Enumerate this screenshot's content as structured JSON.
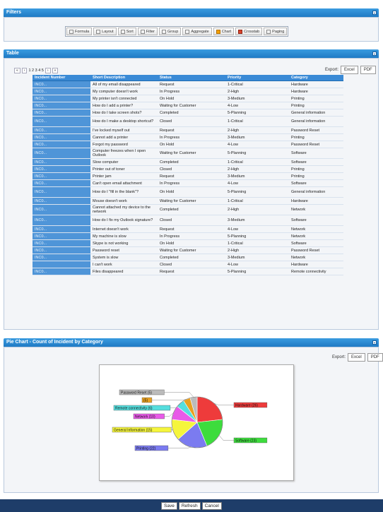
{
  "filters": {
    "title": "Filters",
    "buttons": [
      "Formula",
      "Layout",
      "Sort",
      "Filter",
      "Group",
      "Aggregate",
      "Chart",
      "Crosstab",
      "Paging"
    ]
  },
  "table_panel": {
    "title": "Table",
    "export_label": "Export:",
    "excel": "Excel",
    "pdf": "PDF",
    "pager": {
      "first": "«",
      "prev": "‹",
      "pages": "1 2 3 4 5",
      "next": "›",
      "last": "»"
    },
    "columns": [
      "Incident Number",
      "Short Description",
      "Status",
      "Priority",
      "Category"
    ],
    "rows": [
      [
        "INC0...",
        "All of my email disappeared",
        "Request",
        "1-Critical",
        "Hardware"
      ],
      [
        "INC0...",
        "My computer doesn't work",
        "In Progress",
        "2-High",
        "Hardware"
      ],
      [
        "INC0...",
        "My printer isn't connected",
        "On Hold",
        "3-Medium",
        "Printing"
      ],
      [
        "INC0...",
        "How do I add a printer?",
        "Waiting for Customer",
        "4-Low",
        "Printing"
      ],
      [
        "INC0...",
        "How do I take screen shots?",
        "Completed",
        "5-Planning",
        "General information"
      ],
      [
        "INC0...",
        "How do I make a desktop shortcut?",
        "Closed",
        "1-Critical",
        "General information"
      ],
      [
        "INC0...",
        "I've locked myself out",
        "Request",
        "2-High",
        "Password Reset"
      ],
      [
        "INC0...",
        "Cannot add a printer",
        "In Progress",
        "3-Medium",
        "Printing"
      ],
      [
        "INC0...",
        "Forgot my password",
        "On Hold",
        "4-Low",
        "Password Reset"
      ],
      [
        "INC0...",
        "Computer freezes when I open Outlook",
        "Waiting for Customer",
        "5-Planning",
        "Software"
      ],
      [
        "INC0...",
        "Slow computer",
        "Completed",
        "1-Critical",
        "Software"
      ],
      [
        "INC0...",
        "Printer out of toner",
        "Closed",
        "2-High",
        "Printing"
      ],
      [
        "INC0...",
        "Printer jam",
        "Request",
        "3-Medium",
        "Printing"
      ],
      [
        "INC0...",
        "Can't open email attachment",
        "In Progress",
        "4-Low",
        "Software"
      ],
      [
        "INC0...",
        "How do I \"fill in the blank\"?",
        "On Hold",
        "5-Planning",
        "General information"
      ],
      [
        "INC0...",
        "Mouse doesn't work",
        "Waiting for Customer",
        "1-Critical",
        "Hardware"
      ],
      [
        "INC0...",
        "Cannot attached my device to the network",
        "Completed",
        "2-High",
        "Network"
      ],
      [
        "INC0...",
        "How do I fix my Outlook signature?",
        "Closed",
        "3-Medium",
        "Software"
      ],
      [
        "INC0...",
        "Internet doesn't work",
        "Request",
        "4-Low",
        "Network"
      ],
      [
        "INC0...",
        "My machine is slow",
        "In Progress",
        "5-Planning",
        "Network"
      ],
      [
        "INC0...",
        "Skype is not working",
        "On Hold",
        "1-Critical",
        "Software"
      ],
      [
        "INC0...",
        "Password reset",
        "Waiting for Customer",
        "2-High",
        "Password Reset"
      ],
      [
        "INC0...",
        "System is slow",
        "Completed",
        "3-Medium",
        "Network"
      ],
      [
        "",
        "I can't work",
        "Closed",
        "4-Low",
        "Hardware"
      ],
      [
        "INC0...",
        "Files disappeared",
        "Request",
        "5-Planning",
        "Remote connectivity"
      ]
    ]
  },
  "chart_panel": {
    "title": "Pie Chart - Count of Incident by Category",
    "export_label": "Export:",
    "excel": "Excel",
    "pdf": "PDF"
  },
  "chart_data": {
    "type": "pie",
    "title": "",
    "slices": [
      {
        "label": "Hardware (26)",
        "value": 26,
        "color": "#ee3b3b"
      },
      {
        "label": "Software (23)",
        "value": 23,
        "color": "#3ddc3d"
      },
      {
        "label": "Printing (22)",
        "value": 22,
        "color": "#7b7bf0"
      },
      {
        "label": "General Information (15)",
        "value": 15,
        "color": "#f5f53c"
      },
      {
        "label": "Network (10)",
        "value": 10,
        "color": "#e85ae8"
      },
      {
        "label": "Remote connectivity (6)",
        "value": 6,
        "color": "#55dede"
      },
      {
        "label": "(5)",
        "value": 5,
        "color": "#e8a020"
      },
      {
        "label": "Password Reset (5)",
        "value": 5,
        "color": "#bbbbbb"
      }
    ]
  },
  "footer": {
    "save": "Save",
    "refresh": "Refresh",
    "cancel": "Cancel"
  }
}
